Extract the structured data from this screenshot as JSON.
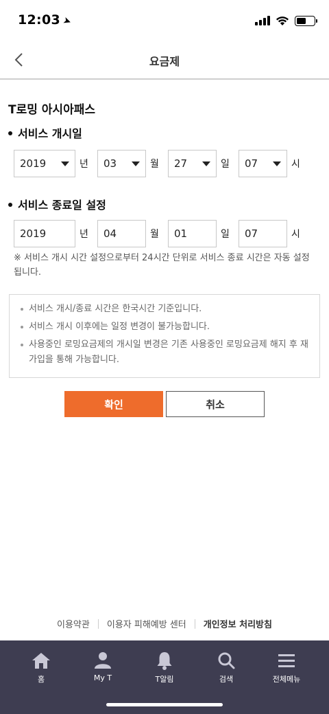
{
  "status_bar": {
    "time": "12:03"
  },
  "header": {
    "title": "요금제"
  },
  "plan": {
    "name": "T로밍 아시아패스"
  },
  "start": {
    "section_title": "서비스 개시일",
    "year": "2019",
    "year_unit": "년",
    "month": "03",
    "month_unit": "월",
    "day": "27",
    "day_unit": "일",
    "hour": "07",
    "hour_unit": "시"
  },
  "end": {
    "section_title": "서비스 종료일 설정",
    "year": "2019",
    "year_unit": "년",
    "month": "04",
    "month_unit": "월",
    "day": "01",
    "day_unit": "일",
    "hour": "07",
    "hour_unit": "시",
    "note": "※ 서비스 개시 시간 설정으로부터 24시간 단위로 서비스 종료 시간은 자동 설정 됩니다."
  },
  "info": {
    "items": [
      "서비스 개시/종료 시간은 한국시간 기준입니다.",
      "서비스 개시 이후에는 일정 변경이 불가능합니다.",
      "사용중인 로밍요금제의 개시일 변경은 기존 사용중인 로밍요금제 해지 후 재가입을 통해 가능합니다."
    ]
  },
  "buttons": {
    "confirm": "확인",
    "cancel": "취소"
  },
  "footer": {
    "terms": "이용약관",
    "damage_center": "이용자 피해예방 센터",
    "privacy": "개인정보 처리방침"
  },
  "tabbar": {
    "home": "홈",
    "myt": "My T",
    "alarm": "T알림",
    "search": "검색",
    "menu": "전체메뉴"
  },
  "colors": {
    "accent": "#ee6c2c",
    "tabbar_bg": "#3e3d51"
  }
}
